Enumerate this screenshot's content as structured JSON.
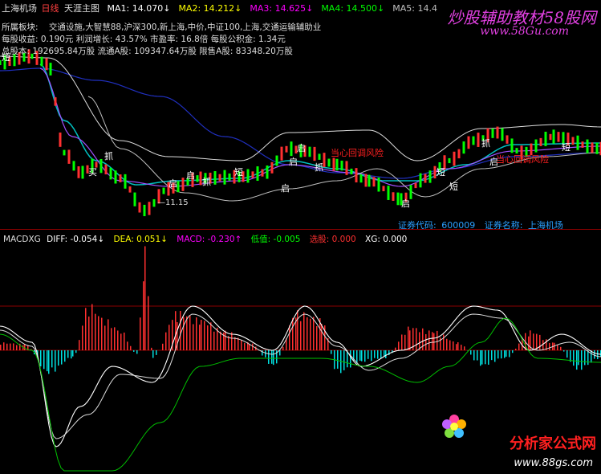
{
  "title_bar": {
    "stock_name": "上海机场",
    "period": "日线",
    "indicator_name": "天涯主图",
    "ma": [
      {
        "label": "MA1:",
        "value": "14.070",
        "arrow": "↓",
        "color": "#ffffff"
      },
      {
        "label": "MA2:",
        "value": "14.212",
        "arrow": "↓",
        "color": "#ffff00"
      },
      {
        "label": "MA3:",
        "value": "14.625",
        "arrow": "↓",
        "color": "#ff00ff"
      },
      {
        "label": "MA4:",
        "value": "14.500",
        "arrow": "↓",
        "color": "#00ff00"
      },
      {
        "label": "MA5:",
        "value": "14.4",
        "arrow": "",
        "color": "#c0c0c0"
      }
    ]
  },
  "info": {
    "line1_label": "所属板块:",
    "line1_value": "交通设施,大智慧88,沪深300,新上海,中价,中证100,上海,交通运输辅助业",
    "line2": "每股收益: 0.190元   利润增长: 43.57%   市盈率: 16.8倍   每股公积金: 1.34元",
    "line3": "总股本: 192695.84万股   流通A股: 109347.64万股   限售A股: 83348.20万股"
  },
  "watermark": {
    "main": "炒股辅助教材58股网",
    "url": "www.58Gu.com"
  },
  "signal_labels": [
    "短",
    "买",
    "抓",
    "启",
    "启",
    "抓",
    "短",
    "启",
    "启",
    "抓",
    "短",
    "短",
    "短",
    "抓",
    "启",
    "启",
    "启"
  ],
  "red_labels": [
    "当心回调风险",
    "当心回调风险"
  ],
  "low_price_label": "11.15",
  "stock_info": {
    "code_label": "证券代码:",
    "code": "600009",
    "name_label": "证券名称:",
    "name": "上海机场"
  },
  "macd_bar": {
    "name": "MACDXG",
    "diff_label": "DIFF:",
    "diff_value": "-0.054↓",
    "dea_label": "DEA:",
    "dea_value": "0.051↓",
    "macd_label": "MACD:",
    "macd_value": "-0.230↑",
    "low_label": "低值:",
    "low_value": "-0.005",
    "pick_label": "选股:",
    "pick_value": "0.000",
    "xg_label": "XG:",
    "xg_value": "0.000"
  },
  "brand": {
    "name": "分析家公式网",
    "url": "www.88gs.com"
  },
  "colors": {
    "up": "#ff3030",
    "down": "#00e0e0",
    "green": "#00ff00",
    "cyan": "#00c0c0",
    "ma_slow": "#2030c0"
  }
}
